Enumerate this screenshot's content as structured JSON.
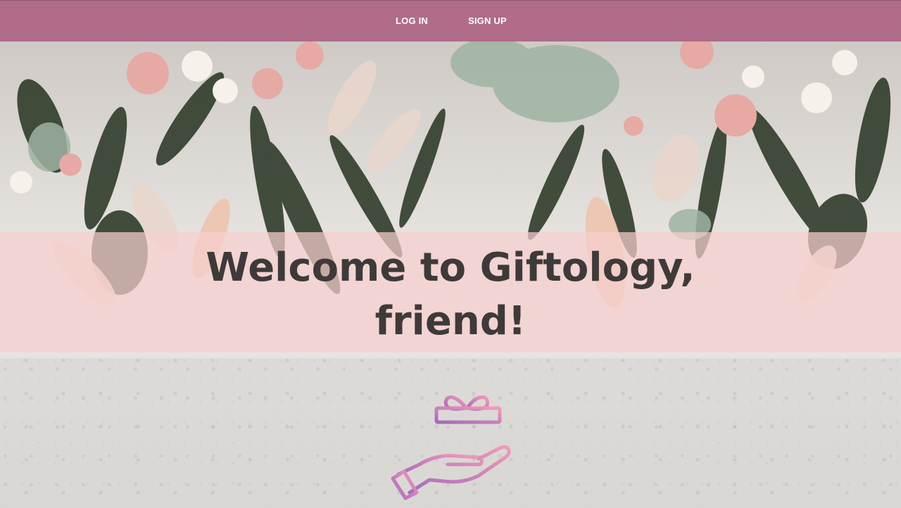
{
  "nav": {
    "login_label": "LOG IN",
    "signup_label": "SIGN UP",
    "bar_color": "#b06c89"
  },
  "hero": {
    "title_line1": "Welcome to Giftology,",
    "title_line2": "friend!",
    "band_color": "#f6cfcd",
    "image": "floral-arrangement-photo"
  },
  "logo": {
    "icon": "gift-in-hand-icon",
    "gradient_start": "#a569bd",
    "gradient_end": "#f29bb8"
  }
}
